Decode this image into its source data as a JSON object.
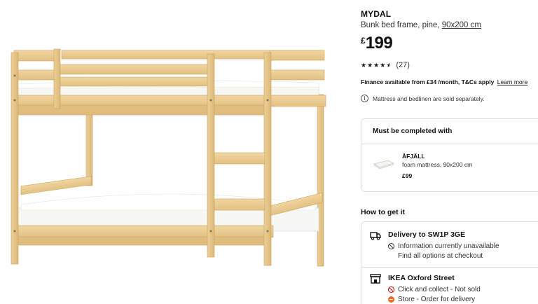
{
  "product": {
    "name": "MYDAL",
    "description": "Bunk bed frame, pine, ",
    "size_link": "90x200 cm",
    "price_currency": "£",
    "price_amount": "199",
    "rating_value": 4.5,
    "review_count": "(27)"
  },
  "finance": {
    "text": "Finance available from £34 /month, T&Cs apply",
    "learn_more": "Learn more"
  },
  "note": {
    "icon": "info-icon",
    "text": "Mattress and bedlinen are sold separately."
  },
  "must_complete": {
    "heading": "Must be completed with",
    "item": {
      "name": "ÅFJÄLL",
      "desc": "foam mattress, 90x200 cm",
      "price": "£99"
    }
  },
  "how_to_get": {
    "heading": "How to get it",
    "delivery": {
      "icon": "truck-icon",
      "title": "Delivery to SW1P 3GE",
      "status": "Information currently unavailable",
      "link": "Find all options at checkout"
    },
    "store": {
      "icon": "store-icon",
      "title": "IKEA Oxford Street",
      "click_collect": "Click and collect - Not sold",
      "store_order": "Store - Order for delivery"
    }
  },
  "colors": {
    "pine": "#e8c98d",
    "pine_dark": "#c9a463",
    "mattress": "#f7f7f5",
    "red": "#cc0008",
    "orange": "#f26a21"
  }
}
